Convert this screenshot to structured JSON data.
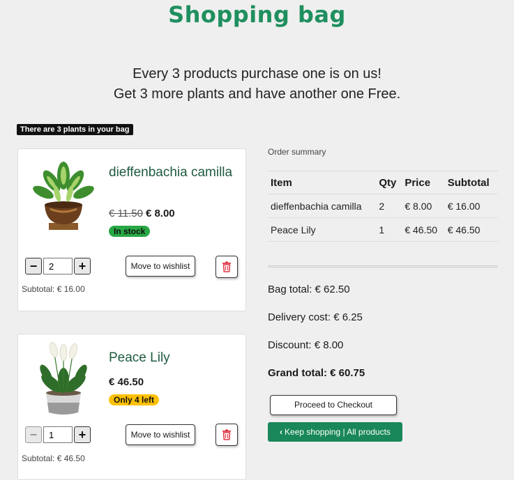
{
  "header": {
    "title": "Shopping bag"
  },
  "promo": {
    "line1": "Every 3 products purchase one is on us!",
    "line2": "Get 3 more plants and have another one Free."
  },
  "bag_count": "There are 3 plants in your bag",
  "items": [
    {
      "name": "dieffenbachia camilla",
      "old_price": "€ 11.50",
      "price": "€ 8.00",
      "stock": "In stock",
      "qty": "2",
      "wishlist_label": "Move to wishlist",
      "subtotal": "Subtotal: € 16.00",
      "image_icon": "dieffenbachia-plant-image"
    },
    {
      "name": "Peace Lily",
      "price": "€ 46.50",
      "stock": "Only 4 left",
      "qty": "1",
      "wishlist_label": "Move to wishlist",
      "subtotal": "Subtotal: € 46.50",
      "image_icon": "peace-lily-plant-image"
    }
  ],
  "summary": {
    "label": "Order summary",
    "columns": [
      "Item",
      "Qty",
      "Price",
      "Subtotal"
    ],
    "rows": [
      [
        "dieffenbachia camilla",
        "2",
        "€ 8.00",
        "€ 16.00"
      ],
      [
        "Peace Lily",
        "1",
        "€ 46.50",
        "€ 46.50"
      ]
    ],
    "bag_total": "Bag total: € 62.50",
    "delivery": "Delivery cost: € 6.25",
    "discount": "Discount: € 8.00",
    "grand_total": "Grand total: € 60.75"
  },
  "actions": {
    "checkout": "Proceed to Checkout",
    "keep_shopping": "Keep shopping | All products"
  },
  "colors": {
    "title": "#1f8f5f",
    "in_stock": "#28a745",
    "low_stock": "#ffc107",
    "keep_btn": "#19875a",
    "delete_icon": "#dc3545"
  }
}
